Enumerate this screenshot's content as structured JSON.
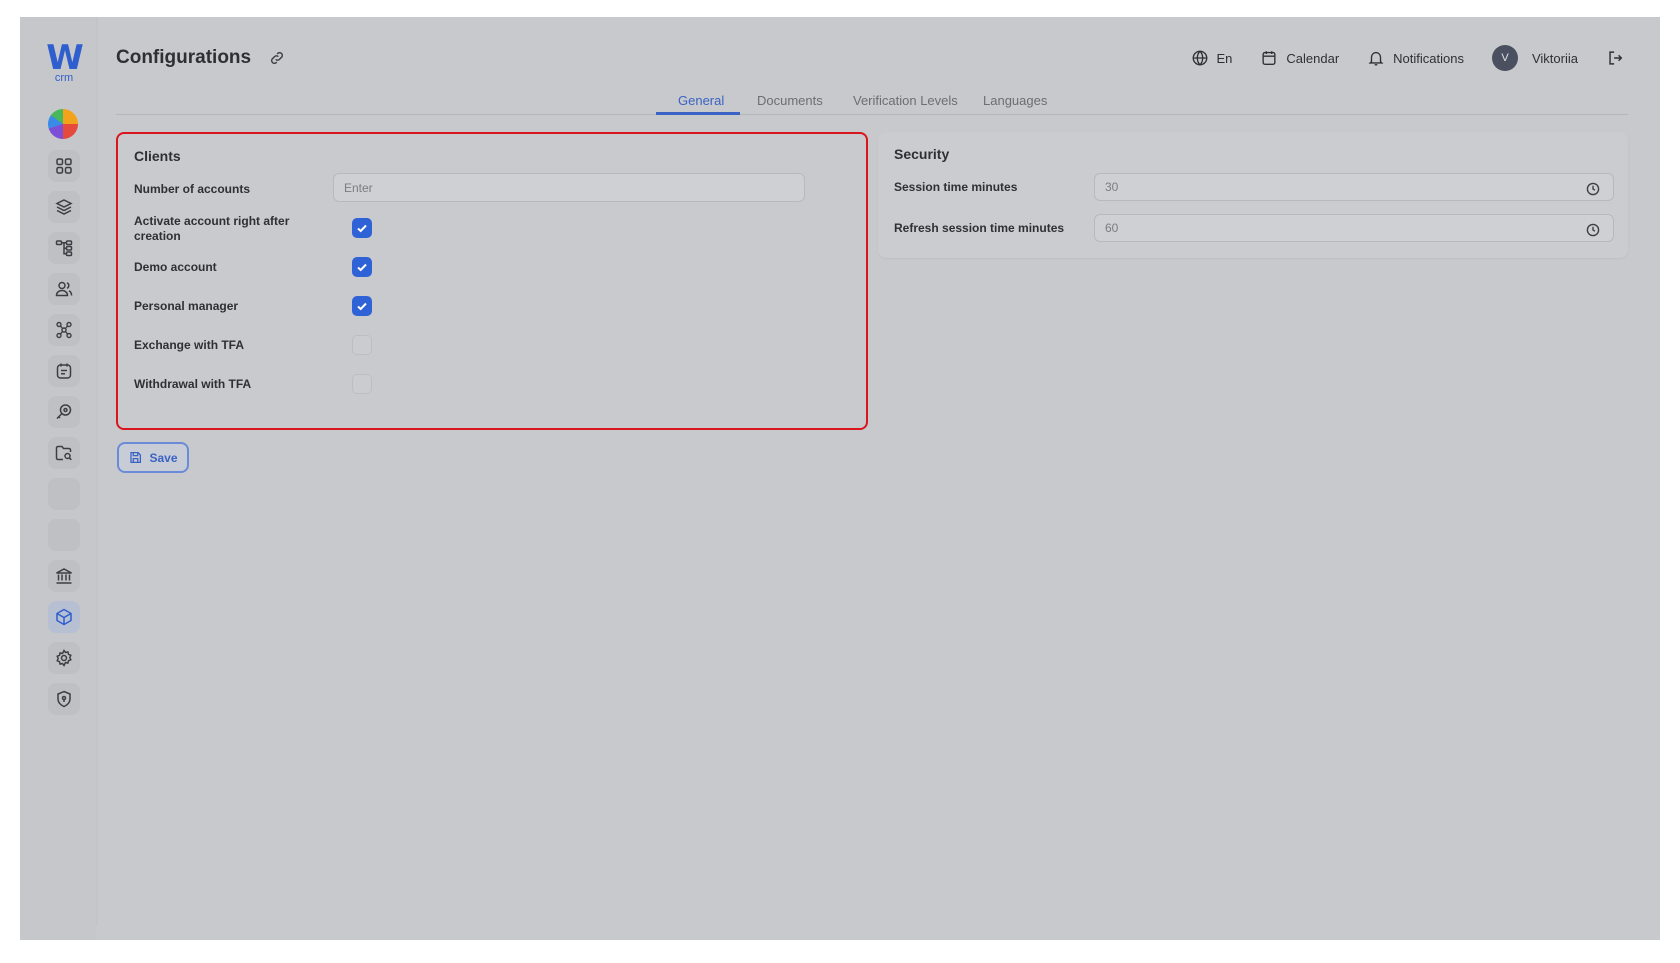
{
  "brand": {
    "logo_letter": "W",
    "logo_sub": "crm"
  },
  "header": {
    "title": "Configurations",
    "language": "En",
    "calendar": "Calendar",
    "notifications": "Notifications",
    "user_initial": "V",
    "user_name": "Viktoriia"
  },
  "tabs": [
    {
      "label": "General",
      "active": true
    },
    {
      "label": "Documents",
      "active": false
    },
    {
      "label": "Verification Levels",
      "active": false
    },
    {
      "label": "Languages",
      "active": false
    }
  ],
  "clients": {
    "title": "Clients",
    "number_of_accounts": {
      "label": "Number of accounts",
      "value": "",
      "placeholder": "Enter"
    },
    "options": [
      {
        "label": "Activate account right after creation",
        "checked": true
      },
      {
        "label": "Demo account",
        "checked": true
      },
      {
        "label": "Personal manager",
        "checked": true
      },
      {
        "label": "Exchange with TFA",
        "checked": false
      },
      {
        "label": "Withdrawal with TFA",
        "checked": false
      }
    ]
  },
  "security": {
    "title": "Security",
    "session_time": {
      "label": "Session time minutes",
      "value": "30"
    },
    "refresh_session_time": {
      "label": "Refresh session time minutes",
      "value": "60"
    }
  },
  "actions": {
    "save_label": "Save"
  },
  "sidebar": {
    "icons": [
      "dashboard-icon",
      "layers-icon",
      "hierarchy-icon",
      "users-icon",
      "network-icon",
      "tasks-icon",
      "key-search-icon",
      "folder-search-icon",
      "blank-icon",
      "blank-icon",
      "bank-icon",
      "cube-icon",
      "gear-icon",
      "shield-icon"
    ],
    "active_icon": "cube-icon"
  },
  "colors": {
    "accent": "#2f62d6",
    "highlight_border": "#d9161c"
  }
}
